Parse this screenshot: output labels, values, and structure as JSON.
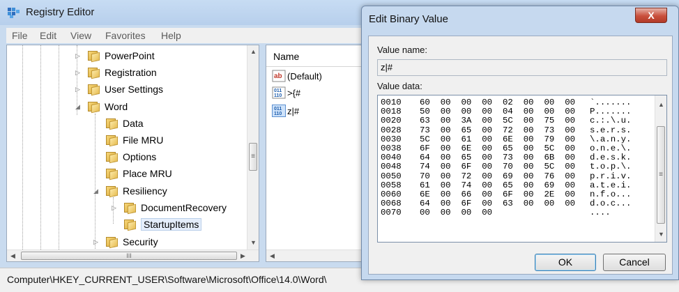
{
  "window": {
    "title": "Registry Editor"
  },
  "menu": [
    "File",
    "Edit",
    "View",
    "Favorites",
    "Help"
  ],
  "tree": {
    "items": [
      {
        "label": "PowerPoint",
        "expander": "▷"
      },
      {
        "label": "Registration",
        "expander": "▷"
      },
      {
        "label": "User Settings",
        "expander": "▷"
      },
      {
        "label": "Word",
        "expander": "◢"
      },
      {
        "label": "Data",
        "expander": ""
      },
      {
        "label": "File MRU",
        "expander": ""
      },
      {
        "label": "Options",
        "expander": ""
      },
      {
        "label": "Place MRU",
        "expander": ""
      },
      {
        "label": "Resiliency",
        "expander": "◢"
      },
      {
        "label": "DocumentRecovery",
        "expander": "▷"
      },
      {
        "label": "StartupItems",
        "expander": ""
      },
      {
        "label": "Security",
        "expander": "▷"
      }
    ],
    "scroll_thumb_glyph": "≡",
    "hscroll_thumb_glyph": "III"
  },
  "values_pane": {
    "column_name": "Name",
    "items": [
      {
        "icon": "string-value-icon",
        "label": "(Default)",
        "icon_text": "ab"
      },
      {
        "icon": "binary-value-icon",
        "label": ">{#",
        "icon_text": "011\n110"
      },
      {
        "icon": "binary-value-icon",
        "label": "z|#",
        "icon_text": "011\n110"
      }
    ]
  },
  "statusbar": {
    "path": "Computer\\HKEY_CURRENT_USER\\Software\\Microsoft\\Office\\14.0\\Word\\"
  },
  "dialog": {
    "title": "Edit Binary Value",
    "close_label": "X",
    "value_name_label": "Value name:",
    "value_name": "z|#",
    "value_data_label": "Value data:",
    "rows": [
      {
        "offset": "0010",
        "bytes": "60  00  00  00  02  00  00  00",
        "ascii": "`......."
      },
      {
        "offset": "0018",
        "bytes": "50  00  00  00  04  00  00  00",
        "ascii": "P......."
      },
      {
        "offset": "0020",
        "bytes": "63  00  3A  00  5C  00  75  00",
        "ascii": "c.:.\\.u."
      },
      {
        "offset": "0028",
        "bytes": "73  00  65  00  72  00  73  00",
        "ascii": "s.e.r.s."
      },
      {
        "offset": "0030",
        "bytes": "5C  00  61  00  6E  00  79  00",
        "ascii": "\\.a.n.y."
      },
      {
        "offset": "0038",
        "bytes": "6F  00  6E  00  65  00  5C  00",
        "ascii": "o.n.e.\\."
      },
      {
        "offset": "0040",
        "bytes": "64  00  65  00  73  00  6B  00",
        "ascii": "d.e.s.k."
      },
      {
        "offset": "0048",
        "bytes": "74  00  6F  00  70  00  5C  00",
        "ascii": "t.o.p.\\."
      },
      {
        "offset": "0050",
        "bytes": "70  00  72  00  69  00  76  00",
        "ascii": "p.r.i.v."
      },
      {
        "offset": "0058",
        "bytes": "61  00  74  00  65  00  69  00",
        "ascii": "a.t.e.i."
      },
      {
        "offset": "0060",
        "bytes": "6E  00  66  00  6F  00  2E  00",
        "ascii": "n.f.o..."
      },
      {
        "offset": "0068",
        "bytes": "64  00  6F  00  63  00  00  00",
        "ascii": "d.o.c..."
      },
      {
        "offset": "0070",
        "bytes": "00  00  00  00",
        "ascii": "...."
      }
    ],
    "ok_label": "OK",
    "cancel_label": "Cancel",
    "scroll_thumb_glyph": "≡"
  }
}
